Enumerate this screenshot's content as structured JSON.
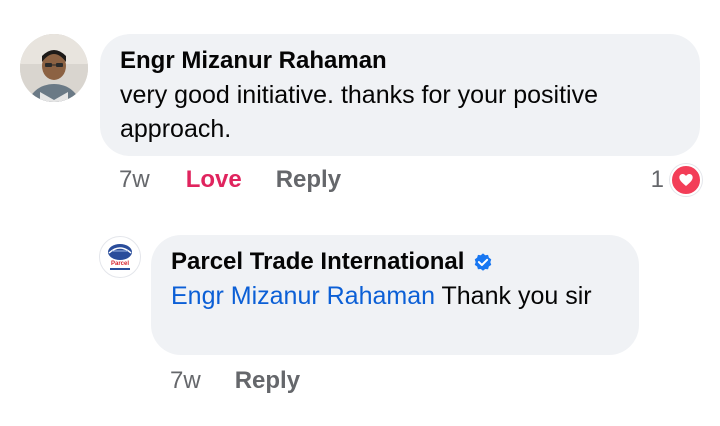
{
  "comment": {
    "author": "Engr Mizanur Rahaman",
    "text": "very good initiative. thanks for your positive approach.",
    "time": "7w",
    "love_label": "Love",
    "reply_label": "Reply",
    "reaction_count": "1",
    "reaction_icon": "heart-icon",
    "reaction_color": "#f33e58"
  },
  "reply": {
    "author": "Parcel Trade International",
    "verified_icon": "verified-badge-icon",
    "mention": "Engr Mizanur Rahaman",
    "text": " Thank you sir",
    "time": "7w",
    "reply_label": "Reply",
    "avatar_text": "Parcel"
  },
  "colors": {
    "bubble": "#f0f2f5",
    "love": "#e0245e",
    "mention": "#0b5fd6",
    "verified": "#1877f2",
    "meta": "#65676b"
  }
}
